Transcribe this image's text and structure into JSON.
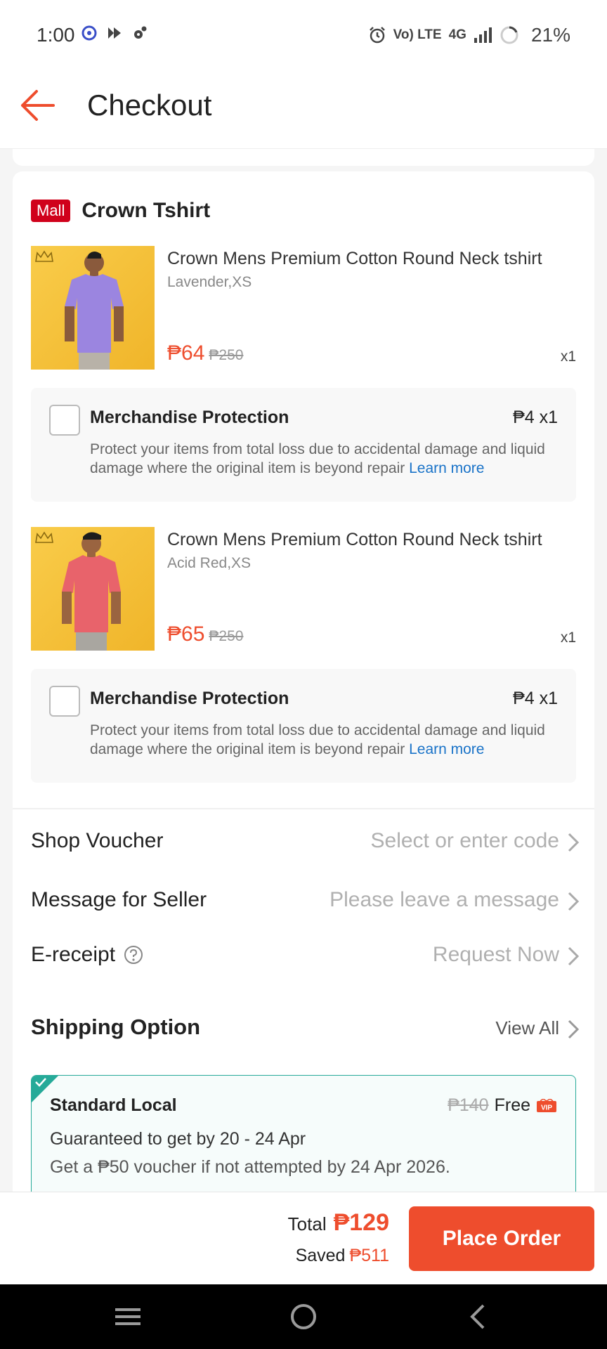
{
  "status_bar": {
    "time": "1:00",
    "network_label": "4G",
    "volte_label": "Vo) LTE",
    "battery": "21%"
  },
  "header": {
    "title": "Checkout"
  },
  "shop": {
    "badge": "Mall",
    "name": "Crown Tshirt"
  },
  "items": [
    {
      "name": "Crown Mens Premium Cotton Round Neck tshirt",
      "variant": "Lavender,XS",
      "price": "₱64",
      "original_price": "₱250",
      "qty": "x1",
      "shirt_color": "#9b85e0",
      "protection": {
        "title": "Merchandise Protection",
        "price": "₱4 x1",
        "description": "Protect your items from total loss due to accidental damage and liquid damage where the original item is beyond repair",
        "link": "Learn more"
      }
    },
    {
      "name": "Crown Mens Premium Cotton Round Neck tshirt",
      "variant": "Acid Red,XS",
      "price": "₱65",
      "original_price": "₱250",
      "qty": "x1",
      "shirt_color": "#e8636b",
      "protection": {
        "title": "Merchandise Protection",
        "price": "₱4 x1",
        "description": "Protect your items from total loss due to accidental damage and liquid damage where the original item is beyond repair",
        "link": "Learn more"
      }
    }
  ],
  "options": {
    "shop_voucher": {
      "label": "Shop Voucher",
      "value": "Select or enter code"
    },
    "message": {
      "label": "Message for Seller",
      "placeholder": "Please leave a message"
    },
    "ereceipt": {
      "label": "E-receipt",
      "value": "Request Now"
    }
  },
  "shipping": {
    "title": "Shipping Option",
    "view_all": "View All",
    "option_name": "Standard Local",
    "old_fee": "₱140",
    "fee": "Free",
    "vip_badge": "VIP",
    "guarantee": "Guaranteed to get by 20 - 24 Apr",
    "voucher_note": "Get a ₱50 voucher if not attempted by 24 Apr 2026."
  },
  "footer": {
    "total_label": "Total",
    "total_value": "₱129",
    "saved_label": "Saved",
    "saved_value": "₱511",
    "place_order": "Place Order"
  },
  "colors": {
    "accent": "#ee4d2d",
    "mall_red": "#d0011b",
    "shipping_teal": "#26aa99",
    "link_blue": "#1a73c8"
  }
}
